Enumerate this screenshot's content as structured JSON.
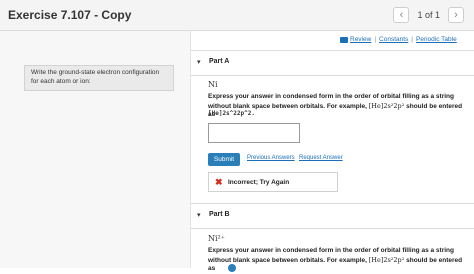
{
  "header": {
    "title": "Exercise 7.107 - Copy",
    "pager": {
      "prev_icon": "chevron-left-icon",
      "prev_glyph": "‹",
      "count": "1 of 1",
      "next_icon": "chevron-right-icon",
      "next_glyph": "›"
    }
  },
  "sidebar": {
    "prompt": "Write the ground-state electron configuration for each atom or ion:"
  },
  "links": {
    "review": "Review",
    "sep": "|",
    "constants": "Constants",
    "periodic_table": "Periodic Table"
  },
  "part_a": {
    "toggle_glyph": "▾",
    "label": "Part A",
    "species": "Ni",
    "instr_1": "Express your answer in condensed form in the order of orbital filling as a string without blank space between orbitals. For example, ",
    "instr_math": "[He]2s²2p²",
    "instr_2": " should be entered as",
    "example": "[He]2s^22p^2.",
    "input_value": "",
    "submit_label": "Submit",
    "previous_answers": "Previous Answers",
    "request_answer": "Request Answer",
    "feedback_icon": "✖",
    "feedback_text": "Incorrect; Try Again"
  },
  "part_b": {
    "toggle_glyph": "▾",
    "label": "Part B",
    "species": "Ni²⁺",
    "instr_1": "Express your answer in condensed form in the order of orbital filling as a string without blank space between orbitals. For example, ",
    "instr_math": "[He]2s²2p²",
    "instr_2": " should be entered as"
  },
  "colors": {
    "accent": "#2a7fb8",
    "link": "#1b6fb7",
    "error": "#d42a1a"
  }
}
